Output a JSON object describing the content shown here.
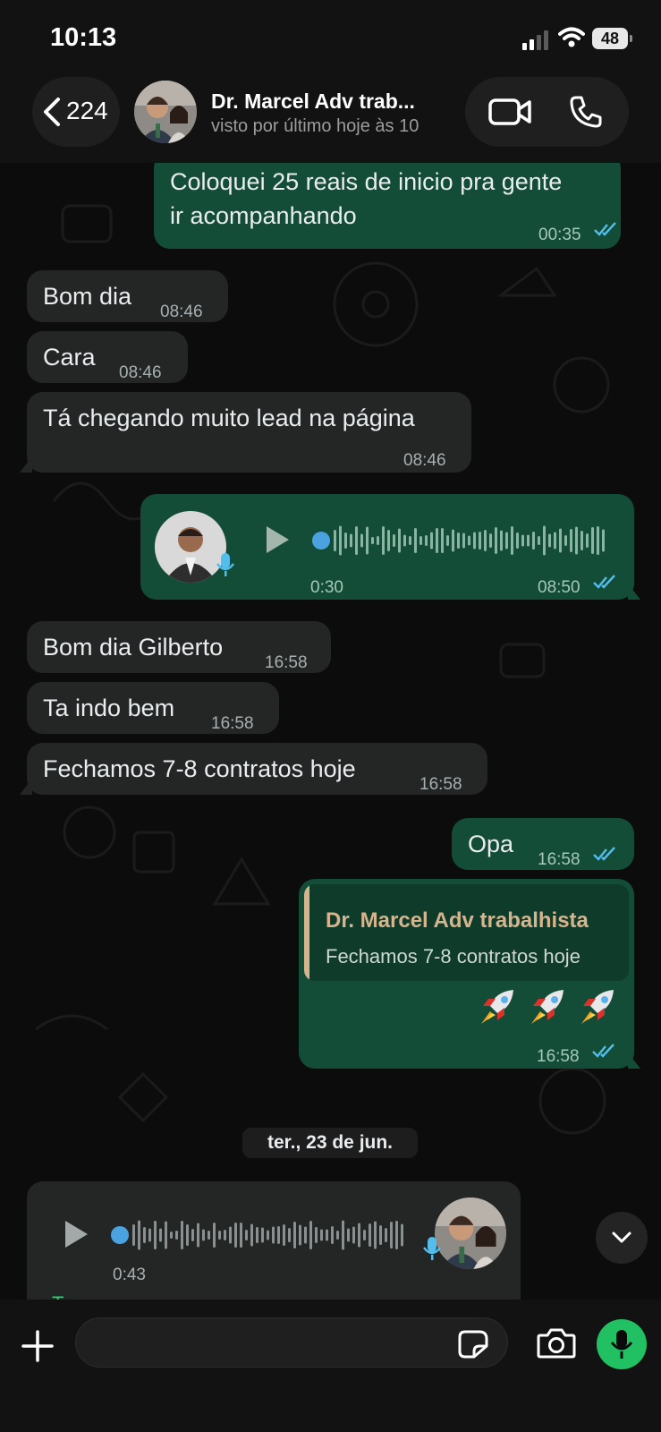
{
  "status_bar": {
    "time": "10:13",
    "battery": "48",
    "icons": [
      "signal-icon",
      "wifi-icon",
      "battery-icon"
    ]
  },
  "header": {
    "back_count": "224",
    "contact_name": "Dr. Marcel Adv trab...",
    "last_seen": "visto por último hoje às 10",
    "icons": [
      "chevron-left-icon",
      "video-call-icon",
      "phone-icon"
    ]
  },
  "messages": [
    {
      "direction": "outgoing",
      "type": "text",
      "lines": [
        "Coloquei 25 reais de inicio pra gente",
        "ir acompanhando"
      ],
      "time": "00:35",
      "status": "read"
    },
    {
      "direction": "incoming",
      "type": "text",
      "text": "Bom dia",
      "time": "08:46"
    },
    {
      "direction": "incoming",
      "type": "text",
      "text": "Cara",
      "time": "08:46"
    },
    {
      "direction": "incoming",
      "type": "text",
      "text": "Tá chegando muito lead na página",
      "time": "08:46"
    },
    {
      "direction": "outgoing",
      "type": "voice",
      "duration": "0:30",
      "time": "08:50",
      "status": "read",
      "progress": 0
    },
    {
      "direction": "incoming",
      "type": "text",
      "text": "Bom dia Gilberto",
      "time": "16:58"
    },
    {
      "direction": "incoming",
      "type": "text",
      "text": "Ta indo bem",
      "time": "16:58"
    },
    {
      "direction": "incoming",
      "type": "text",
      "text": "Fechamos 7-8 contratos hoje",
      "time": "16:58"
    },
    {
      "direction": "outgoing",
      "type": "text",
      "text": "Opa",
      "time": "16:58",
      "status": "read"
    },
    {
      "direction": "outgoing",
      "type": "reply",
      "quoted_author": "Dr. Marcel Adv trabalhista",
      "quoted_text": "Fechamos 7-8 contratos hoje",
      "text": "🚀🚀🚀",
      "time": "16:58",
      "status": "read"
    },
    {
      "direction": "incoming",
      "type": "voice",
      "duration": "0:43",
      "progress": 0,
      "action": "Transcrever"
    }
  ],
  "date_separator": "ter., 23 de jun.",
  "composer": {
    "placeholder": "",
    "icons": [
      "plus-icon",
      "sticker-icon",
      "camera-icon",
      "microphone-icon"
    ]
  },
  "colors": {
    "incoming_bubble": "#242626",
    "outgoing_bubble": "#134d37",
    "accent_green": "#21c063",
    "read_ticks": "#53bdeb",
    "quote_author": "#d6b48d"
  }
}
